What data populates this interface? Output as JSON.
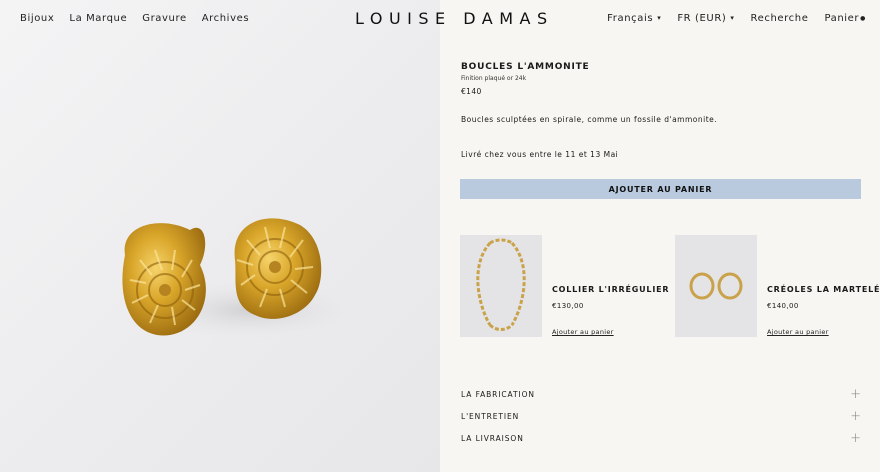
{
  "nav_left": [
    "Bijoux",
    "La Marque",
    "Gravure",
    "Archives"
  ],
  "logo": "LOUISE DAMAS",
  "nav_right": {
    "language": "Français",
    "currency": "FR (EUR)",
    "search": "Recherche",
    "cart": "Panier"
  },
  "product": {
    "title": "BOUCLES L'AMMONITE",
    "subtitle": "Finition plaqué or 24k",
    "price": "€140",
    "description": "Boucles sculptées en spirale, comme un fossile d'ammonite.",
    "shipping": "Livré chez vous entre le 11 et 13 Mai",
    "add_to_cart": "AJOUTER AU PANIER"
  },
  "related": [
    {
      "name": "COLLIER L'IRRÉGULIER",
      "price": "€130,00",
      "link": "Ajouter au panier"
    },
    {
      "name": "CRÉOLES LA MARTELÉE",
      "price": "€140,00",
      "link": "Ajouter au panier"
    }
  ],
  "accordions": [
    "LA FABRICATION",
    "L'ENTRETIEN",
    "LA LIVRAISON"
  ],
  "colors": {
    "button": "#b9cadf",
    "gold": "#d4a52a",
    "background": "#f7f6f2"
  }
}
